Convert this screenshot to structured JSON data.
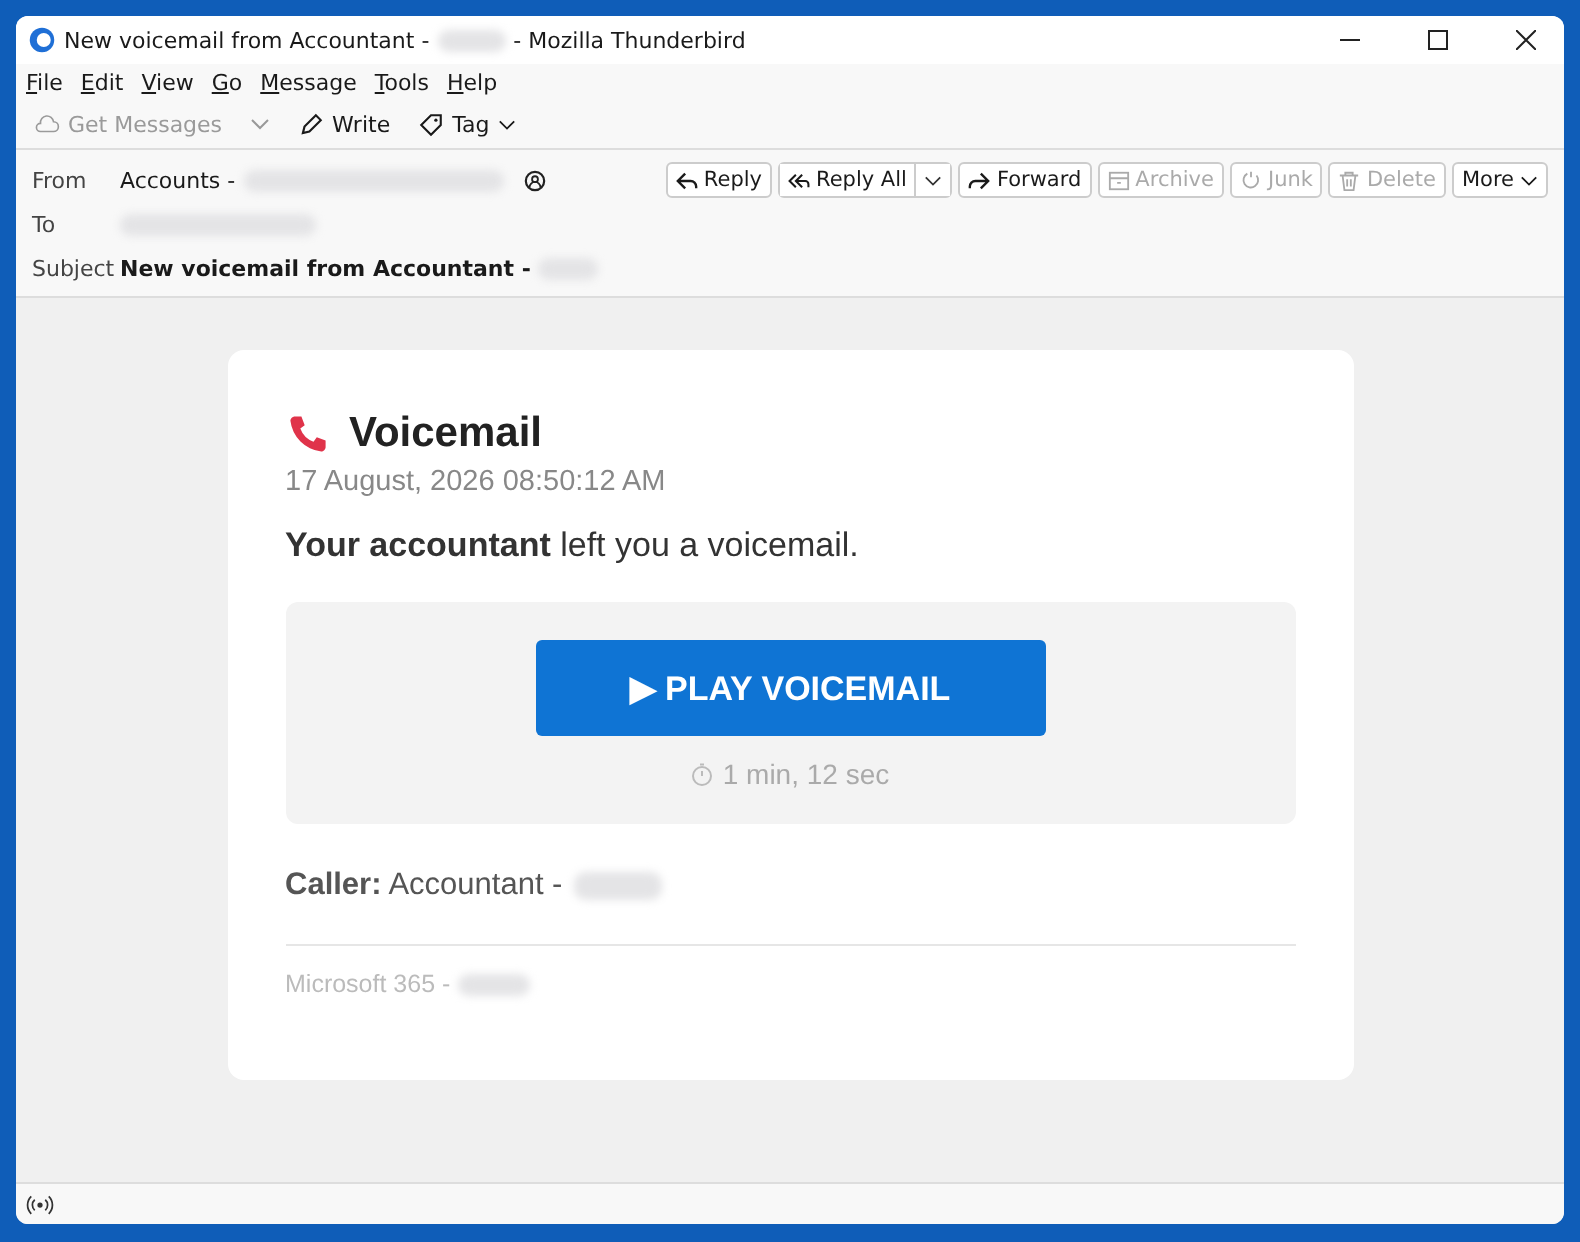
{
  "window": {
    "title_start": "New voicemail from Accountant -",
    "title_end": "- Mozilla Thunderbird"
  },
  "menu": [
    "File",
    "Edit",
    "View",
    "Go",
    "Message",
    "Tools",
    "Help"
  ],
  "toolbar": [
    {
      "kind": "cloud",
      "label": "Get Messages",
      "disabled": true
    },
    {
      "kind": "dropdown"
    },
    {
      "kind": "pencil",
      "label": "Write",
      "disabled": false
    },
    {
      "kind": "tag",
      "label": "Tag",
      "disabled": false
    }
  ],
  "header": {
    "from_label": "From",
    "from_value": "Accounts -",
    "to_label": "To",
    "subject_label": "Subject",
    "subject_value": "New voicemail from Accountant -"
  },
  "actions": [
    {
      "kind": "reply",
      "label": "Reply",
      "disabled": false
    },
    {
      "kind": "replyall",
      "label": "Reply All",
      "disabled": false
    },
    {
      "kind": "forward",
      "label": "Forward",
      "disabled": false
    },
    {
      "kind": "archive",
      "label": "Archive",
      "disabled": true
    },
    {
      "kind": "junk",
      "label": "Junk",
      "disabled": true
    },
    {
      "kind": "delete",
      "label": "Delete",
      "disabled": true
    },
    {
      "kind": "more",
      "label": "More",
      "disabled": false
    }
  ],
  "message": {
    "title": "Voicemail",
    "date": "17 August, 2026 08:50:12 AM",
    "intro": "**Your accountant** left you a voicemail.",
    "play_icon": "▶",
    "play_label": "PLAY VOICEMAIL",
    "duration": "1 min, 12 sec",
    "caller": "**Caller:** Accountant -",
    "footer": "Microsoft 365 -"
  }
}
